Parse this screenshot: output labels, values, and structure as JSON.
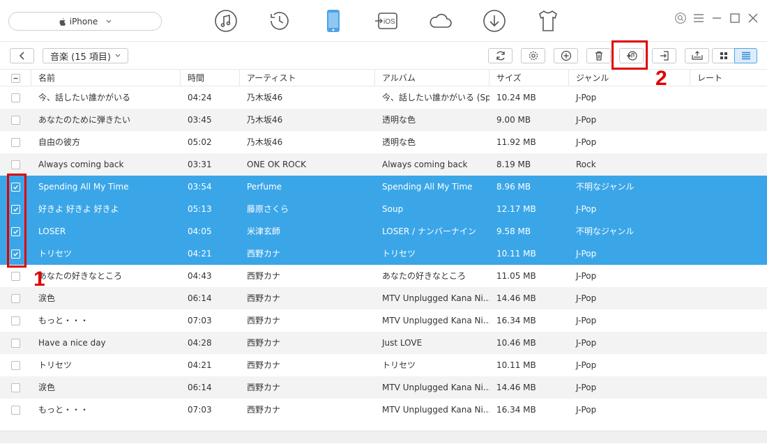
{
  "device": {
    "name": "iPhone"
  },
  "nav": {
    "icons": [
      "music-icon",
      "history-icon",
      "phone-icon",
      "ios-transfer-icon",
      "cloud-icon",
      "download-icon",
      "tshirt-icon"
    ]
  },
  "window_controls": [
    "search-icon",
    "menu-icon",
    "minimize-icon",
    "maximize-icon",
    "close-icon"
  ],
  "toolbar": {
    "category_label": "音楽 (15 項目)",
    "buttons": [
      "refresh-icon",
      "settings-icon",
      "add-icon",
      "delete-icon",
      "to-itunes-icon",
      "to-computer-icon",
      "to-device-icon"
    ],
    "views": [
      "grid-view-icon",
      "list-view-icon"
    ]
  },
  "table": {
    "headers": [
      "名前",
      "時間",
      "アーティスト",
      "アルバム",
      "サイズ",
      "ジャンル",
      "レート"
    ],
    "rows": [
      {
        "name": "今、話したい誰かがいる",
        "time": "04:24",
        "artist": "乃木坂46",
        "album": "今、話したい誰かがいる (Sp...",
        "size": "10.24 MB",
        "genre": "J-Pop",
        "checked": false
      },
      {
        "name": "あなたのために弾きたい",
        "time": "03:45",
        "artist": "乃木坂46",
        "album": "透明な色",
        "size": "9.00 MB",
        "genre": "J-Pop",
        "checked": false
      },
      {
        "name": "自由の彼方",
        "time": "05:02",
        "artist": "乃木坂46",
        "album": "透明な色",
        "size": "11.92 MB",
        "genre": "J-Pop",
        "checked": false
      },
      {
        "name": "Always coming back",
        "time": "03:31",
        "artist": "ONE OK ROCK",
        "album": "Always coming back",
        "size": "8.19 MB",
        "genre": "Rock",
        "checked": false
      },
      {
        "name": "Spending All My Time",
        "time": "03:54",
        "artist": "Perfume",
        "album": "Spending All My Time",
        "size": "8.96 MB",
        "genre": "不明なジャンル",
        "checked": true
      },
      {
        "name": "好きよ 好きよ 好きよ",
        "time": "05:13",
        "artist": "藤原さくら",
        "album": "Soup",
        "size": "12.17 MB",
        "genre": "J-Pop",
        "checked": true
      },
      {
        "name": "LOSER",
        "time": "04:05",
        "artist": "米津玄師",
        "album": "LOSER / ナンバーナイン",
        "size": "9.58 MB",
        "genre": "不明なジャンル",
        "checked": true
      },
      {
        "name": "トリセツ",
        "time": "04:21",
        "artist": "西野カナ",
        "album": "トリセツ",
        "size": "10.11 MB",
        "genre": "J-Pop",
        "checked": true
      },
      {
        "name": "あなたの好きなところ",
        "time": "04:43",
        "artist": "西野カナ",
        "album": "あなたの好きなところ",
        "size": "11.05 MB",
        "genre": "J-Pop",
        "checked": false
      },
      {
        "name": "涙色",
        "time": "06:14",
        "artist": "西野カナ",
        "album": "MTV Unplugged Kana Ni...",
        "size": "14.46 MB",
        "genre": "J-Pop",
        "checked": false
      },
      {
        "name": "もっと・・・",
        "time": "07:03",
        "artist": "西野カナ",
        "album": "MTV Unplugged Kana Ni...",
        "size": "16.34 MB",
        "genre": "J-Pop",
        "checked": false
      },
      {
        "name": "Have a nice day",
        "time": "04:28",
        "artist": "西野カナ",
        "album": "Just LOVE",
        "size": "10.46 MB",
        "genre": "J-Pop",
        "checked": false
      },
      {
        "name": "トリセツ",
        "time": "04:21",
        "artist": "西野カナ",
        "album": "トリセツ",
        "size": "10.11 MB",
        "genre": "J-Pop",
        "checked": false
      },
      {
        "name": "涙色",
        "time": "06:14",
        "artist": "西野カナ",
        "album": "MTV Unplugged Kana Ni...",
        "size": "14.46 MB",
        "genre": "J-Pop",
        "checked": false
      },
      {
        "name": "もっと・・・",
        "time": "07:03",
        "artist": "西野カナ",
        "album": "MTV Unplugged Kana Ni...",
        "size": "16.34 MB",
        "genre": "J-Pop",
        "checked": false
      }
    ]
  },
  "annotations": {
    "step1": "1",
    "step2": "2"
  },
  "colors": {
    "selected_row": "#3aa6e8",
    "accent": "#4fa3e6",
    "annotation": "#e00000"
  }
}
